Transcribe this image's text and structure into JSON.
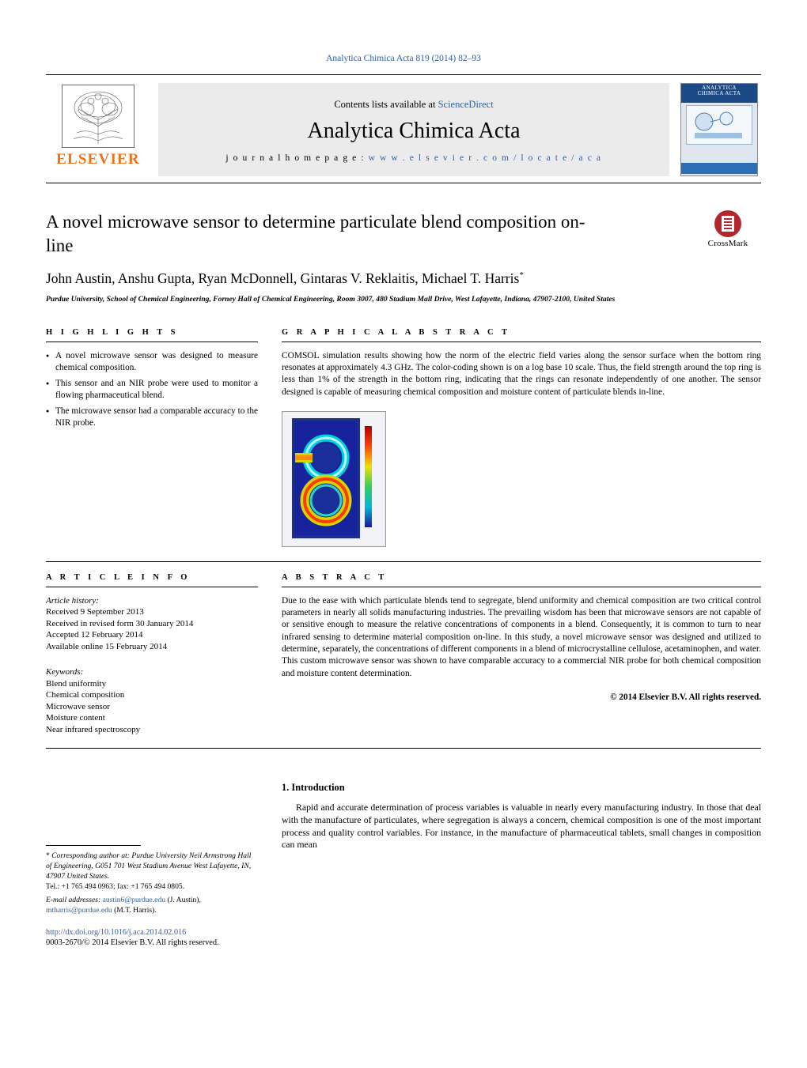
{
  "journal_ref": "Analytica Chimica Acta 819 (2014) 82–93",
  "masthead": {
    "contents_prefix": "Contents lists available at ",
    "contents_link": "ScienceDirect",
    "journal_title": "Analytica Chimica Acta",
    "homepage_label": "j o u r n a l   h o m e p a g e :",
    "homepage_url": "w w w . e l s e v i e r . c o m / l o c a t e / a c a",
    "publisher": "ELSEVIER",
    "cover_line1": "ANALYTICA",
    "cover_line2": "CHIMICA ACTA"
  },
  "article": {
    "title": "A novel microwave sensor to determine particulate blend composition on-line",
    "authors": "John Austin, Anshu Gupta, Ryan McDonnell, Gintaras V. Reklaitis, Michael T. Harris",
    "author_star": "*",
    "affiliation": "Purdue University, School of Chemical Engineering, Forney Hall of Chemical Engineering, Room 3007, 480 Stadium Mall Drive, West Lafayette, Indiana, 47907-2100, United States",
    "crossmark_label": "CrossMark"
  },
  "highlights": {
    "heading": "H I G H L I G H T S",
    "items": [
      "A novel microwave sensor was designed to measure chemical composition.",
      "This sensor and an NIR probe were used to monitor a flowing pharmaceutical blend.",
      "The microwave sensor had a comparable accuracy to the NIR probe."
    ]
  },
  "graphical_abstract": {
    "heading": "G R A P H I C A L   A B S T R A C T",
    "text": "COMSOL simulation results showing how the norm of the electric field varies along the sensor surface when the bottom ring resonates at approximately 4.3 GHz. The color-coding shown is on a log base 10 scale. Thus, the field strength around the top ring is less than 1% of the strength in the bottom ring, indicating that the rings can resonate independently of one another. The sensor designed is capable of measuring chemical composition and moisture content of particulate blends in-line."
  },
  "article_info": {
    "heading": "A R T I C L E   I N F O",
    "history_label": "Article history:",
    "history": [
      "Received 9 September 2013",
      "Received in revised form 30 January 2014",
      "Accepted 12 February 2014",
      "Available online 15 February 2014"
    ],
    "keywords_label": "Keywords:",
    "keywords": [
      "Blend uniformity",
      "Chemical composition",
      "Microwave sensor",
      "Moisture content",
      "Near infrared spectroscopy"
    ]
  },
  "abstract": {
    "heading": "A B S T R A C T",
    "text": "Due to the ease with which particulate blends tend to segregate, blend uniformity and chemical composition are two critical control parameters in nearly all solids manufacturing industries. The prevailing wisdom has been that microwave sensors are not capable of or sensitive enough to measure the relative concentrations of components in a blend. Consequently, it is common to turn to near infrared sensing to determine material composition on-line. In this study, a novel microwave sensor was designed and utilized to determine, separately, the concentrations of different components in a blend of microcrystalline cellulose, acetaminophen, and water. This custom microwave sensor was shown to have comparable accuracy to a commercial NIR probe for both chemical composition and moisture content determination.",
    "copyright": "© 2014 Elsevier B.V. All rights reserved."
  },
  "footnote": {
    "star": "*",
    "corresponding": "Corresponding author at: Purdue University Neil Armstrong Hall of Engineering, G051 701 West Stadium Avenue West Lafayette, IN, 47907 United States.",
    "tel": "Tel.: +1 765 494 0963; fax: +1 765 494 0805.",
    "email_label": "E-mail addresses:",
    "email1": "austin6@purdue.edu",
    "email1_name": "(J. Austin),",
    "email2": "mtharris@purdue.edu",
    "email2_name": "(M.T. Harris).",
    "doi": "http://dx.doi.org/10.1016/j.aca.2014.02.016",
    "issn": "0003-2670/© 2014 Elsevier B.V. All rights reserved."
  },
  "introduction": {
    "heading": "1.  Introduction",
    "text": "Rapid and accurate determination of process variables is valuable in nearly every manufacturing industry. In those that deal with the manufacture of particulates, where segregation is always a concern, chemical composition is one of the most important process and quality control variables. For instance, in the manufacture of pharmaceutical tablets, small changes in composition can mean"
  },
  "colors": {
    "link": "#2e5fa3",
    "elsevier_orange": "#e8731a",
    "crossmark_red": "#b3262c"
  }
}
